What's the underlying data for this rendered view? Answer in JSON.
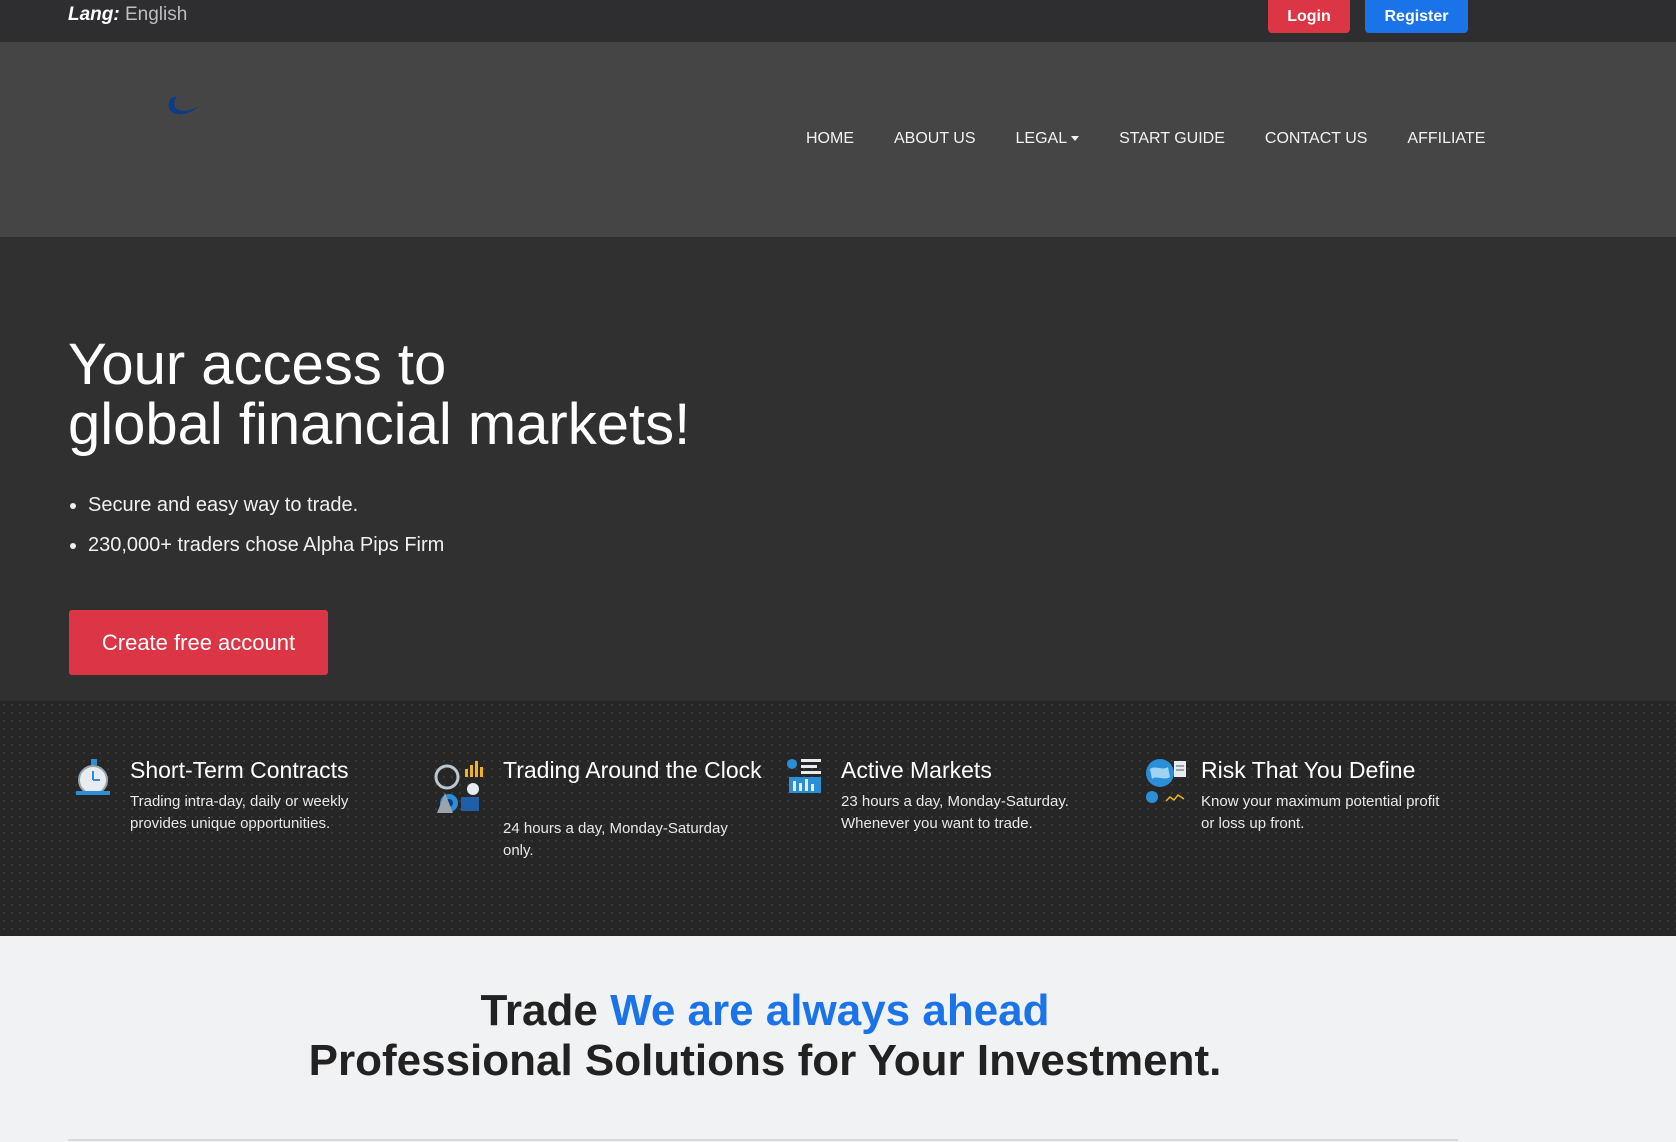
{
  "topbar": {
    "lang_label": "Lang:",
    "lang_value": "English",
    "login_label": "Login",
    "register_label": "Register"
  },
  "nav": {
    "logo_icon": "brand-swoosh-logo",
    "items": [
      {
        "label": "HOME"
      },
      {
        "label": "ABOUT US"
      },
      {
        "label": "LEGAL"
      },
      {
        "label": "START GUIDE"
      },
      {
        "label": "CONTACT US"
      },
      {
        "label": "AFFILIATE"
      }
    ]
  },
  "hero": {
    "title_line1": "Your access to",
    "title_line2": "global financial markets!",
    "bullets": [
      "Secure and easy way to trade.",
      "230,000+ traders chose Alpha Pips Firm"
    ],
    "cta_label": "Create free account"
  },
  "features": [
    {
      "icon": "stopwatch-icon",
      "title": "Short-Term Contracts",
      "text": "Trading intra-day, daily or weekly provides unique opportunities."
    },
    {
      "icon": "clock-chart-icon",
      "title": "Trading Around the Clock",
      "text": "24 hours a day, Monday-Saturday only."
    },
    {
      "icon": "market-chart-icon",
      "title": "Active Markets",
      "text": "23 hours a day, Monday-Saturday. Whenever you want to trade."
    },
    {
      "icon": "globe-risk-icon",
      "title": "Risk That You Define",
      "text": "Know your maximum potential profit or loss up front."
    }
  ],
  "bottom": {
    "headline_prefix": "Trade",
    "headline_accent": "We are always ahead",
    "headline_line2": "Professional Solutions for Your Investment."
  },
  "colors": {
    "accent_red": "#dc3545",
    "accent_blue": "#1a73e8",
    "topbar_bg": "#2e2e30",
    "navbar_bg": "#454546",
    "hero_bg": "#303031"
  }
}
